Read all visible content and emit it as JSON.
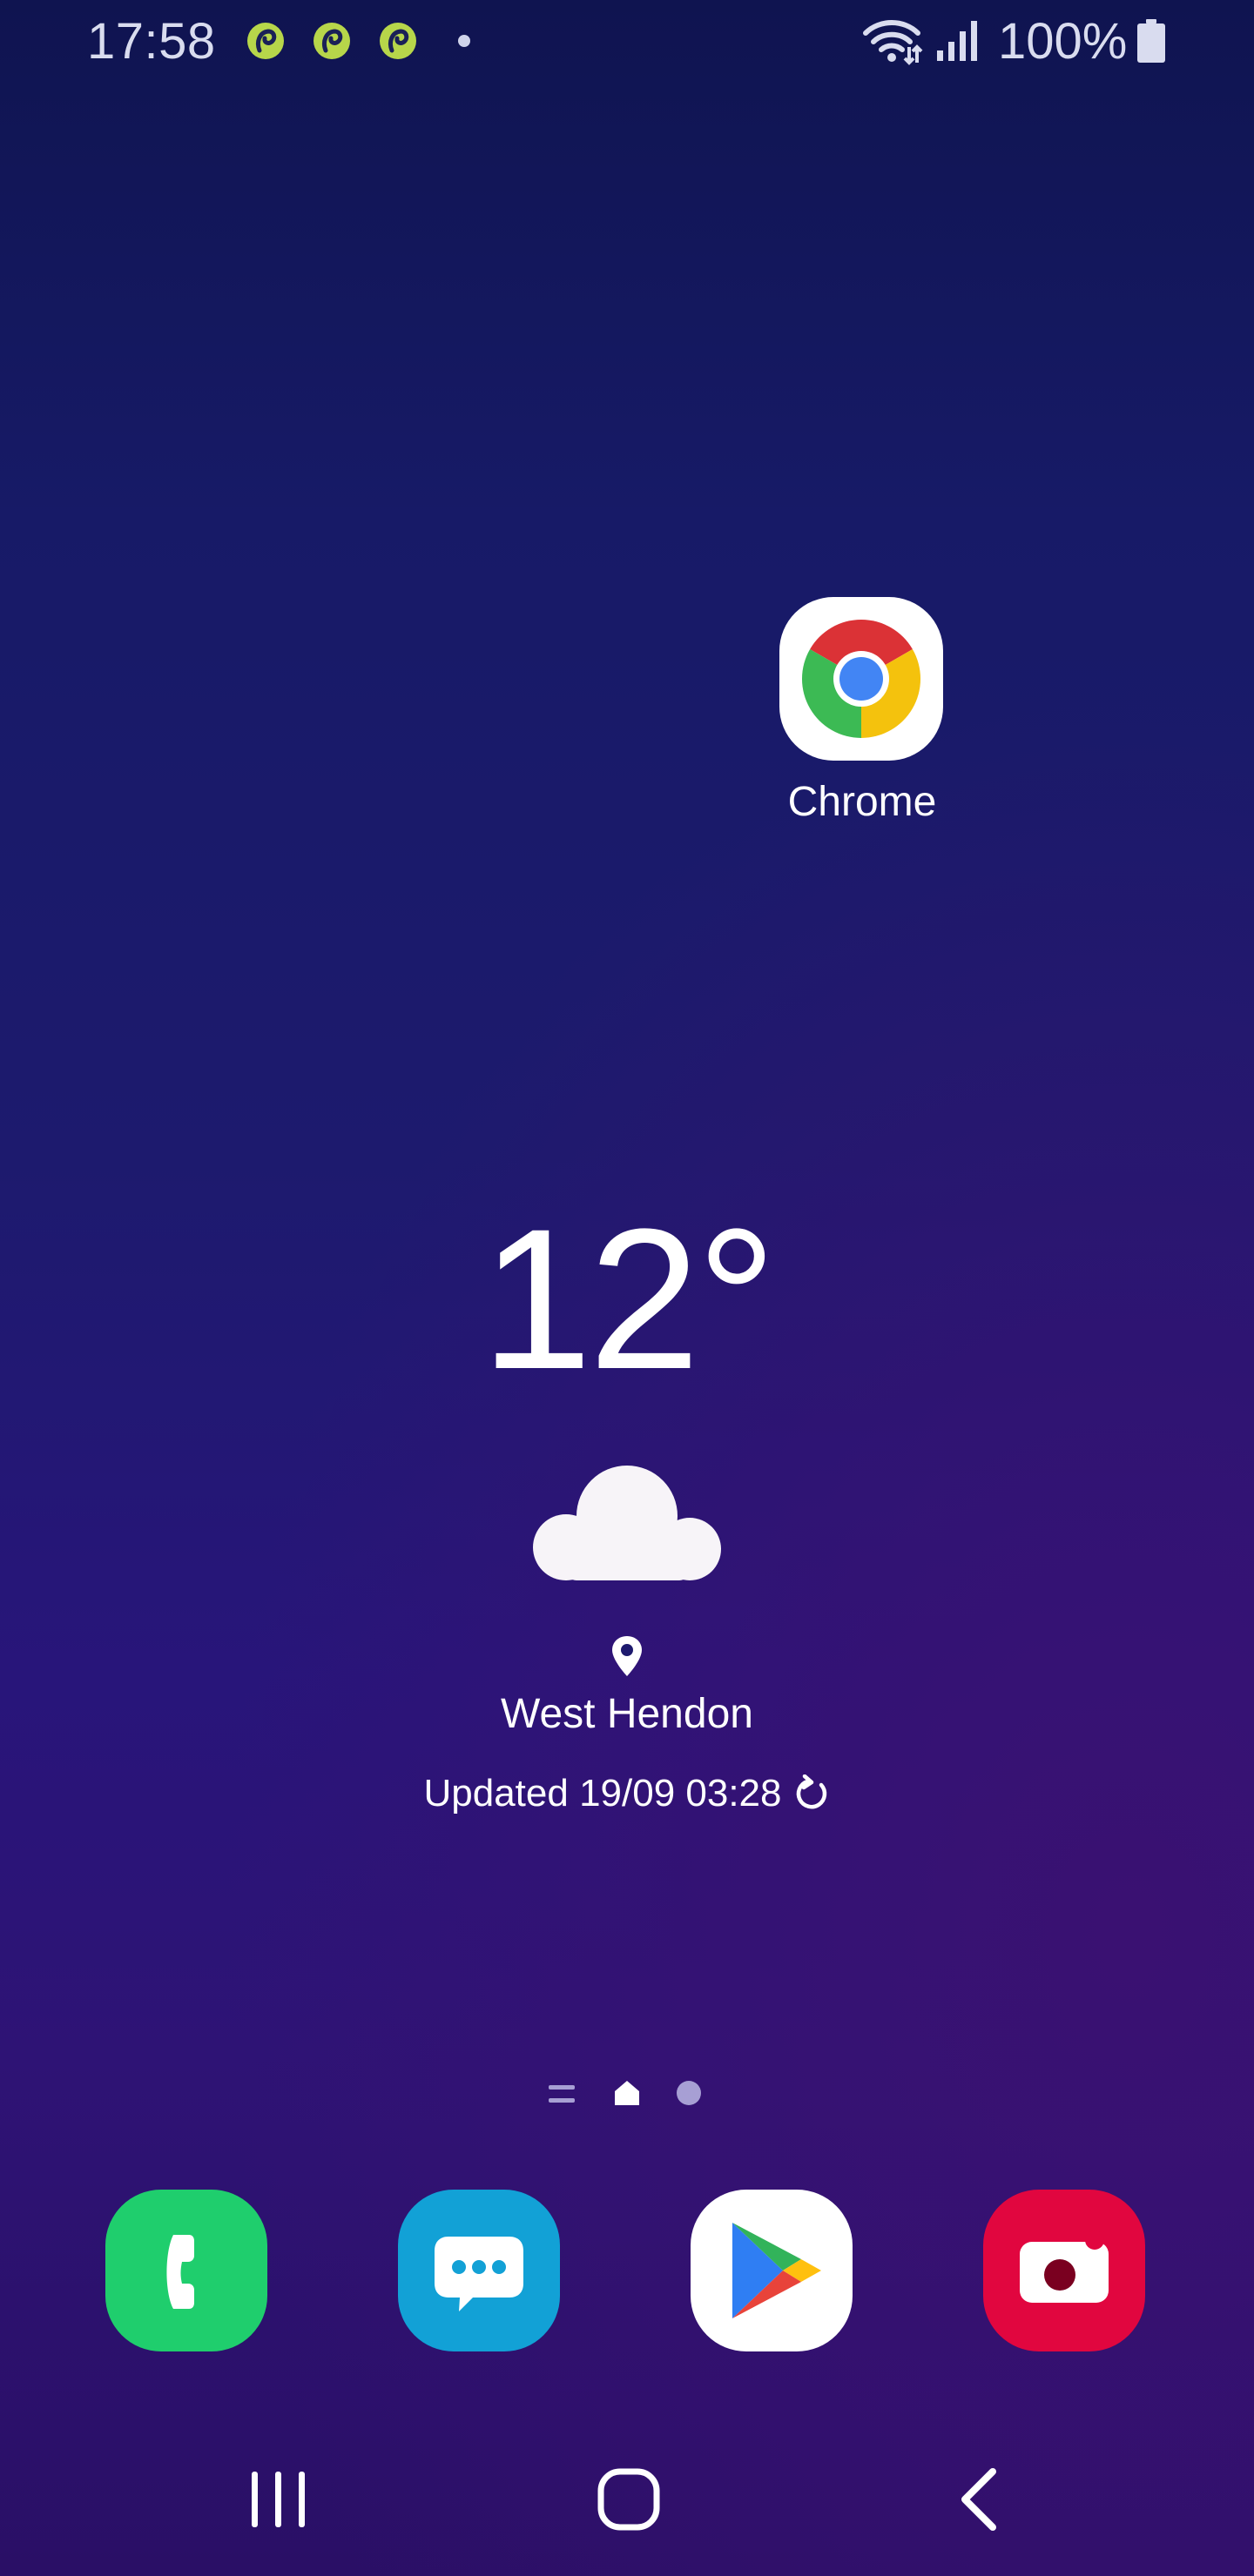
{
  "status_bar": {
    "time": "17:58",
    "notification_icons": [
      "app-notification-icon",
      "app-notification-icon",
      "app-notification-icon"
    ],
    "battery_percent": "100%",
    "icons": [
      "wifi-icon",
      "signal-icon",
      "battery-icon"
    ]
  },
  "home": {
    "shortcut": {
      "label": "Chrome",
      "icon": "chrome-icon"
    }
  },
  "weather": {
    "temperature": "12°",
    "condition_icon": "cloud-icon",
    "location": "West Hendon",
    "updated": "Updated 19/09 03:28"
  },
  "dock": {
    "apps": [
      {
        "name": "phone",
        "icon": "phone-icon",
        "color": "#1fce6d"
      },
      {
        "name": "messages",
        "icon": "messages-icon",
        "color": "#12a1d6"
      },
      {
        "name": "play-store",
        "icon": "play-store-icon",
        "color": "#ffffff"
      },
      {
        "name": "camera",
        "icon": "camera-icon",
        "color": "#e1063f"
      }
    ]
  },
  "nav_bar": {
    "buttons": [
      "recents-icon",
      "home-icon",
      "back-icon"
    ]
  },
  "colors": {
    "wallpaper_top": "#0f1450",
    "wallpaper_bottom": "#2a0f66",
    "notification_accent": "#b7d64a"
  }
}
